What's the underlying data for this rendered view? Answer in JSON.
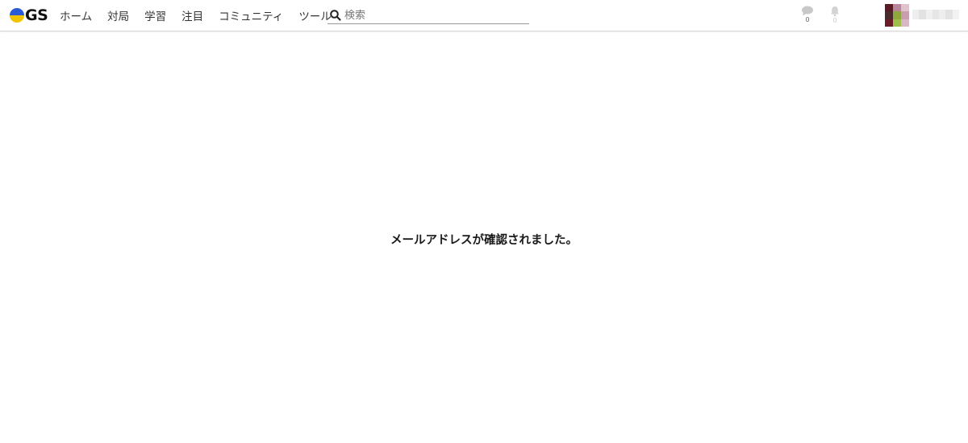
{
  "brand": {
    "logo_text": "GS",
    "colors": {
      "logo_top": "#2a5bd7",
      "logo_bottom": "#f2c400"
    }
  },
  "nav": {
    "links": [
      {
        "label": "ホーム"
      },
      {
        "label": "対局"
      },
      {
        "label": "学習"
      },
      {
        "label": "注目"
      },
      {
        "label": "コミュニティ"
      },
      {
        "label": "ツール"
      }
    ]
  },
  "search": {
    "icon": "search-icon",
    "placeholder": "検索"
  },
  "notifications": {
    "chat": {
      "icon": "chat-bubble-icon",
      "count": "0"
    },
    "bell": {
      "icon": "bell-icon",
      "count": "0"
    }
  },
  "main": {
    "message": "メールアドレスが確認されました。"
  }
}
